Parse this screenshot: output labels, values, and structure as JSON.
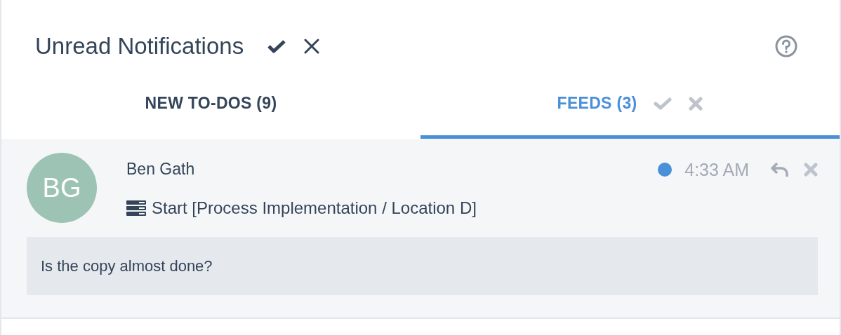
{
  "header": {
    "title": "Unread Notifications"
  },
  "tabs": [
    {
      "label": "NEW TO-DOS (9)",
      "selected": false
    },
    {
      "label": "FEEDS (3)",
      "selected": true
    }
  ],
  "notifications": [
    {
      "initials": "BG",
      "author": "Ben Gath",
      "unread": true,
      "time": "4:33 AM",
      "subject": "Start [Process Implementation / Location D]",
      "message": "Is the copy almost done?"
    }
  ]
}
